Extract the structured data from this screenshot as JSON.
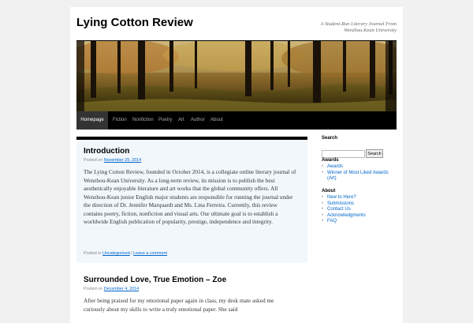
{
  "site": {
    "title": "Lying Cotton Review",
    "description": "A Student-Run Literary Journal From Wenzhou-Kean University"
  },
  "nav": [
    {
      "label": "Homepage",
      "active": true
    },
    {
      "label": "Fiction"
    },
    {
      "label": "Nonfiction"
    },
    {
      "label": "Poetry"
    },
    {
      "label": "Art"
    },
    {
      "label": "Author"
    },
    {
      "label": "About"
    }
  ],
  "posts": [
    {
      "title": "Introduction",
      "meta_prefix": "Posted on",
      "date": "November 29, 2014",
      "body": "The Lying Cotton Review, founded in October 2014, is a collegiate online literary journal of Wenzhou-Kean University. As a long-term review, its mission is to publish the best aesthetically enjoyable literature and art works that the global community offers. All Wenzhou-Kean junior English major students are responsible for running the journal under the direction of Dr. Jennifer Marquardt and Ms. Lina Ferreira. Currently, this review contains poetry, fiction, nonfiction and visual arts. Our ultimate goal is to establish a worldwide English publication of popularity, prestige, independence and integrity.",
      "posted_in": "Posted in",
      "category": "Uncategorized",
      "separator": "|",
      "comment": "Leave a comment"
    },
    {
      "title": "Surrounded Love, True Emotion – Zoe",
      "meta_prefix": "Posted on",
      "date": "December 4, 2014",
      "body": "After being praised for my emotional paper again in class, my desk mate asked me curiously about my skills to write a truly emotional paper. She said"
    }
  ],
  "sidebar": {
    "search": {
      "title": "Search",
      "button": "Search",
      "value": ""
    },
    "awards": {
      "title": "Awards",
      "items": [
        "Awards",
        "Winner of Most Liked Awards (Art)"
      ]
    },
    "about": {
      "title": "About",
      "items": [
        "New to Here?",
        "Submissions",
        "Contact Us",
        "Acknowledgments",
        "FAQ"
      ]
    }
  }
}
